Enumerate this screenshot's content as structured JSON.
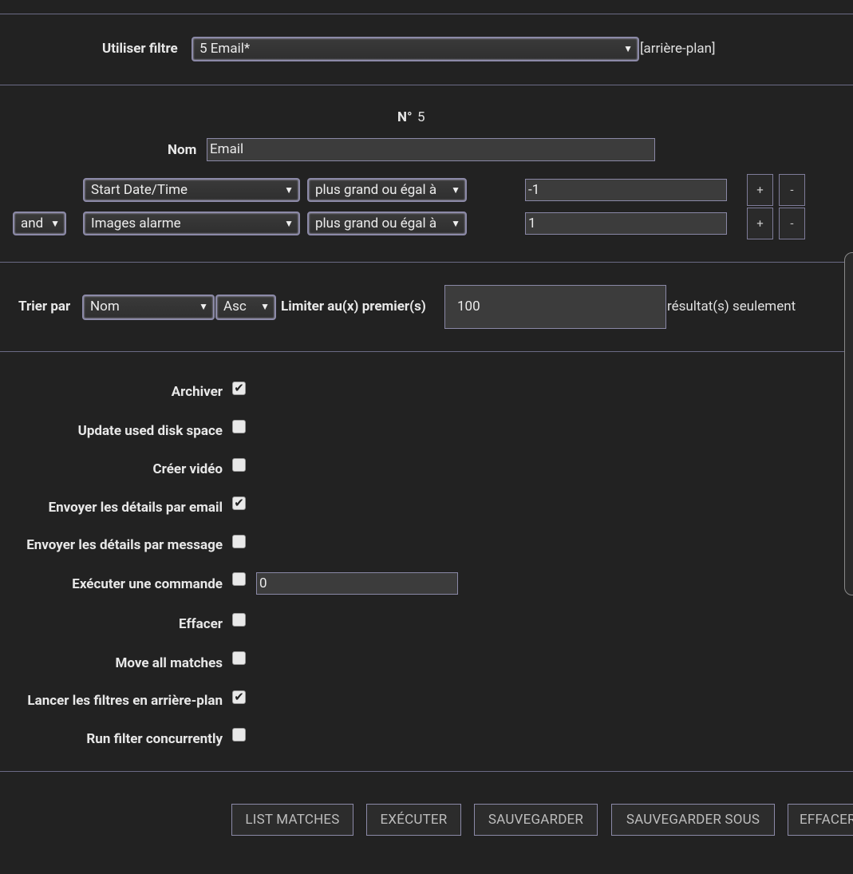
{
  "filter_bar": {
    "label": "Utiliser filtre",
    "selected": "5 Email*",
    "background_note": "[arrière-plan]"
  },
  "filter": {
    "number_label": "N°",
    "number": "5",
    "name_label": "Nom",
    "name_value": "Email",
    "terms": [
      {
        "conjunction": "",
        "attribute": "Start Date/Time",
        "operator": "plus grand ou égal à",
        "value": "-1"
      },
      {
        "conjunction": "and",
        "attribute": "Images alarme",
        "operator": "plus grand ou égal à",
        "value": "1"
      }
    ],
    "add_label": "+",
    "remove_label": "-"
  },
  "sort": {
    "label": "Trier par",
    "field": "Nom",
    "direction": "Asc",
    "limit_label": "Limiter au(x) premier(s)",
    "limit_value": "100",
    "limit_suffix": "résultat(s) seulement"
  },
  "actions": {
    "options": [
      {
        "label": "Archiver",
        "checked": true
      },
      {
        "label": "Update used disk space",
        "checked": false
      },
      {
        "label": "Créer vidéo",
        "checked": false
      },
      {
        "label": "Envoyer les détails par email",
        "checked": true
      },
      {
        "label": "Envoyer les détails par message",
        "checked": false
      },
      {
        "label": "Exécuter une commande",
        "checked": false
      },
      {
        "label": "Effacer",
        "checked": false
      },
      {
        "label": "Move all matches",
        "checked": false
      },
      {
        "label": "Lancer les filtres en arrière-plan",
        "checked": true
      },
      {
        "label": "Run filter concurrently",
        "checked": false
      }
    ],
    "command_value": "0"
  },
  "buttons": {
    "list_matches": "LIST MATCHES",
    "execute": "EXÉCUTER",
    "save": "SAUVEGARDER",
    "save_as": "SAUVEGARDER SOUS",
    "delete": "EFFACER"
  },
  "colors": {
    "background": "#222222",
    "divider": "#6b6a85",
    "border": "#8c8aa8"
  }
}
